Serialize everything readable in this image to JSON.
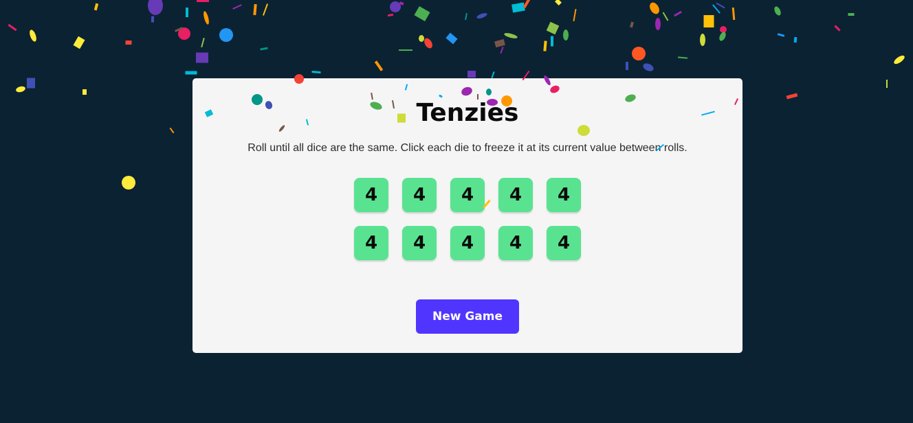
{
  "game": {
    "title": "Tenzies",
    "instructions": "Roll until all dice are the same. Click each die to freeze it at its current value between rolls.",
    "dice": [
      "4",
      "4",
      "4",
      "4",
      "4",
      "4",
      "4",
      "4",
      "4",
      "4"
    ],
    "new_game_label": "New Game"
  },
  "colors": {
    "background": "#0b2233",
    "card": "#f5f5f5",
    "die_held": "#59e391",
    "button": "#5035ff",
    "confetti": [
      "#e91e63",
      "#9c27b0",
      "#673ab7",
      "#3f51b5",
      "#2196f3",
      "#03a9f4",
      "#00bcd4",
      "#009688",
      "#4caf50",
      "#8bc34a",
      "#cddc39",
      "#ffeb3b",
      "#ffc107",
      "#ff9800",
      "#ff5722",
      "#795548",
      "#f44336"
    ]
  }
}
